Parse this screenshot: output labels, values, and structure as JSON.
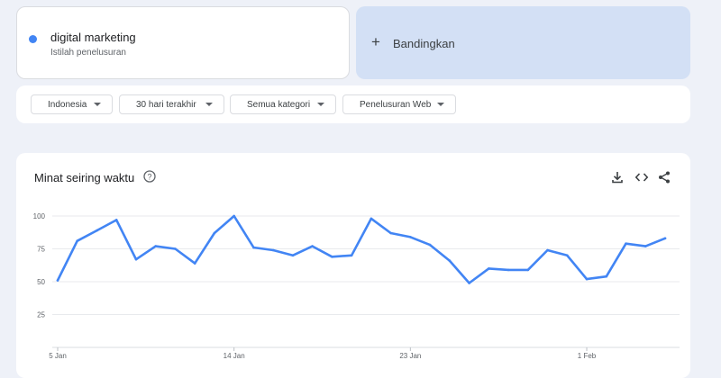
{
  "search_term": {
    "name": "digital marketing",
    "subtitle": "Istilah penelusuran",
    "color": "#4285f4"
  },
  "compare": {
    "label": "Bandingkan",
    "icon": "plus-icon"
  },
  "filters": [
    {
      "label": "Indonesia"
    },
    {
      "label": "30 hari terakhir"
    },
    {
      "label": "Semua kategori"
    },
    {
      "label": "Penelusuran Web"
    }
  ],
  "chart_section": {
    "title": "Minat seiring waktu",
    "actions": [
      "download-icon",
      "embed-icon",
      "share-icon"
    ]
  },
  "chart_data": {
    "type": "line",
    "title": "",
    "xlabel": "",
    "ylabel": "",
    "ylim": [
      0,
      100
    ],
    "y_ticks": [
      25,
      50,
      75,
      100
    ],
    "x_tick_labels": [
      "5 Jan",
      "14 Jan",
      "23 Jan",
      "1 Feb"
    ],
    "x_tick_dates": [
      "2025-01-05",
      "2025-01-14",
      "2025-01-23",
      "2025-02-01"
    ],
    "grid": true,
    "series": [
      {
        "color": "#4285f4",
        "x": [
          "2025-01-05",
          "2025-01-06",
          "2025-01-07",
          "2025-01-08",
          "2025-01-09",
          "2025-01-10",
          "2025-01-11",
          "2025-01-12",
          "2025-01-13",
          "2025-01-14",
          "2025-01-15",
          "2025-01-16",
          "2025-01-17",
          "2025-01-18",
          "2025-01-19",
          "2025-01-20",
          "2025-01-21",
          "2025-01-22",
          "2025-01-23",
          "2025-01-24",
          "2025-01-25",
          "2025-01-26",
          "2025-01-27",
          "2025-01-28",
          "2025-01-29",
          "2025-01-30",
          "2025-01-31",
          "2025-02-01",
          "2025-02-02",
          "2025-02-03",
          "2025-02-04",
          "2025-02-05"
        ],
        "values": [
          51,
          81,
          89,
          97,
          67,
          77,
          75,
          64,
          87,
          100,
          76,
          74,
          70,
          77,
          69,
          70,
          98,
          87,
          84,
          78,
          66,
          49,
          60,
          59,
          59,
          74,
          70,
          52,
          54,
          79,
          77,
          83
        ]
      }
    ]
  }
}
